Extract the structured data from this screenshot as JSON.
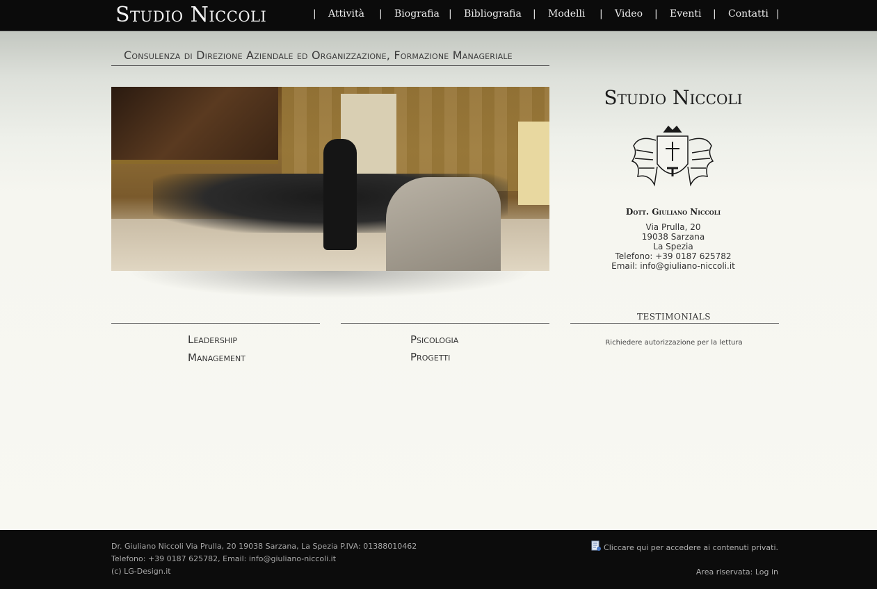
{
  "header": {
    "logo": "Studio Niccoli",
    "nav": [
      {
        "label": "Attività"
      },
      {
        "label": "Biografia"
      },
      {
        "label": "Bibliografia"
      },
      {
        "label": "Modelli"
      },
      {
        "label": "Video"
      },
      {
        "label": "Eventi"
      },
      {
        "label": "Contatti"
      }
    ],
    "separator": "|"
  },
  "tagline": "Consulenza di Direzione Aziendale ed Organizzazione, Formazione Manageriale",
  "sidebar": {
    "title": "Studio Niccoli",
    "crest_icon": "coat-of-arms",
    "name": "Dott. Giuliano Niccoli",
    "address_street": "Via Prulla, 20",
    "address_city": "19038 Sarzana",
    "address_province": "La Spezia",
    "phone": "Telefono: +39 0187 625782",
    "email": "Email: info@giuliano-niccoli.it"
  },
  "columns": {
    "col1_links": [
      "Leadership",
      "Management"
    ],
    "col2_links": [
      "Psicologia",
      "Progetti"
    ],
    "testimonials_title": "TESTIMONIALS",
    "testimonials_text": "Richiedere autorizzazione per la lettura"
  },
  "footer": {
    "line1": "Dr. Giuliano Niccoli Via Prulla, 20 19038 Sarzana, La Spezia P.IVA: 01388010462",
    "line2": "Telefono: +39 0187 625782, Email: info@giuliano-niccoli.it",
    "line3": "(c) LG-Design.it",
    "private_link": "Cliccare qui per accedere ai contenuti privati.",
    "reserved_label": "Area riservata:",
    "login_link": "Log in"
  }
}
